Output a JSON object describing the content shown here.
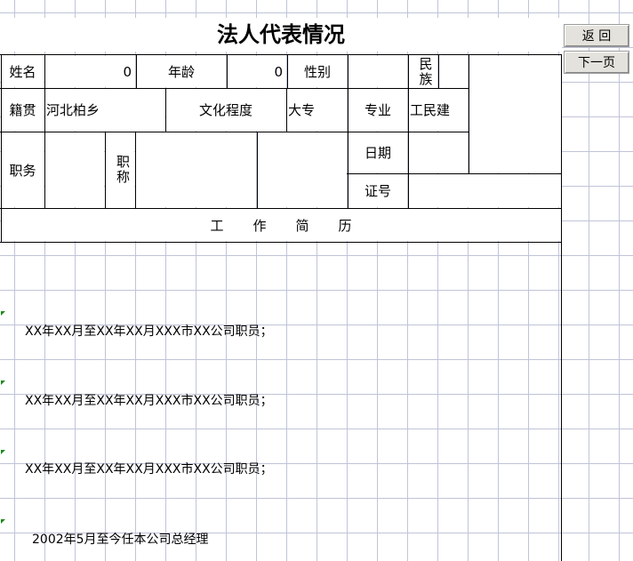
{
  "title": "法人代表情况",
  "buttons": {
    "back": "返    回",
    "next": "下一页"
  },
  "row1": {
    "name_label": "姓名",
    "name_value": "0",
    "age_label": "年龄",
    "age_value": "0",
    "gender_label": "性别",
    "gender_value": "",
    "ethnic_label": "民族",
    "ethnic_value": ""
  },
  "row2": {
    "native_label": "籍贯",
    "native_value": "河北柏乡",
    "education_label": "文化程度",
    "education_value": "大专",
    "major_label": "专业",
    "major_value": "工民建"
  },
  "row3": {
    "position_label": "职务",
    "title_label": "职称",
    "date_label": "日期",
    "cert_label": "证号"
  },
  "resume_header": "工　　作　　简　　历",
  "resume_lines": [
    "XX年XX月至XX年XX月XXX市XX公司职员；",
    "XX年XX月至XX年XX月XXX市XX公司职员；",
    "XX年XX月至XX年XX月XXX市XX公司职员；",
    "2002年5月至今任本公司总经理"
  ]
}
